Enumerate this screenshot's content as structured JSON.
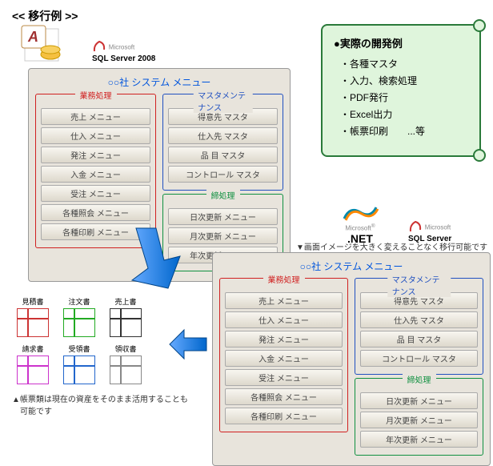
{
  "title": "<< 移行例 >>",
  "logos": {
    "access": "A",
    "sql1": "SQL Server 2008",
    "sql2": "SQL Server",
    "net": "Microsoft\n.NET"
  },
  "panel": {
    "title": "○○社 システム メニュー",
    "groups": {
      "gyomu": {
        "label": "業務処理",
        "items": [
          "売上 メニュー",
          "仕入 メニュー",
          "発注 メニュー",
          "入金 メニュー",
          "受注 メニュー",
          "各種照会 メニュー",
          "各種印刷 メニュー"
        ]
      },
      "master": {
        "label": "マスタメンテナンス",
        "items": [
          "得意先 マスタ",
          "仕入先 マスタ",
          "品 目 マスタ",
          "コントロール マスタ"
        ]
      },
      "shime": {
        "label": "締処理",
        "items": [
          "日次更新 メニュー",
          "月次更新 メニュー",
          "年次更新 メニュー"
        ]
      }
    }
  },
  "note": {
    "title": "●実際の開発例",
    "items": [
      "・各種マスタ",
      "・入力、検索処理",
      "・PDF発行",
      "・Excel出力",
      "・帳票印刷　　...等"
    ]
  },
  "captions": {
    "top": "▼画面イメージを大きく変えることなく移行可能です",
    "bottom": "▲帳票類は現在の資産をそのまま活用することも\n　可能です"
  },
  "docs": [
    "見積書",
    "注文書",
    "売上書",
    "請求書",
    "受領書",
    "領収書"
  ]
}
